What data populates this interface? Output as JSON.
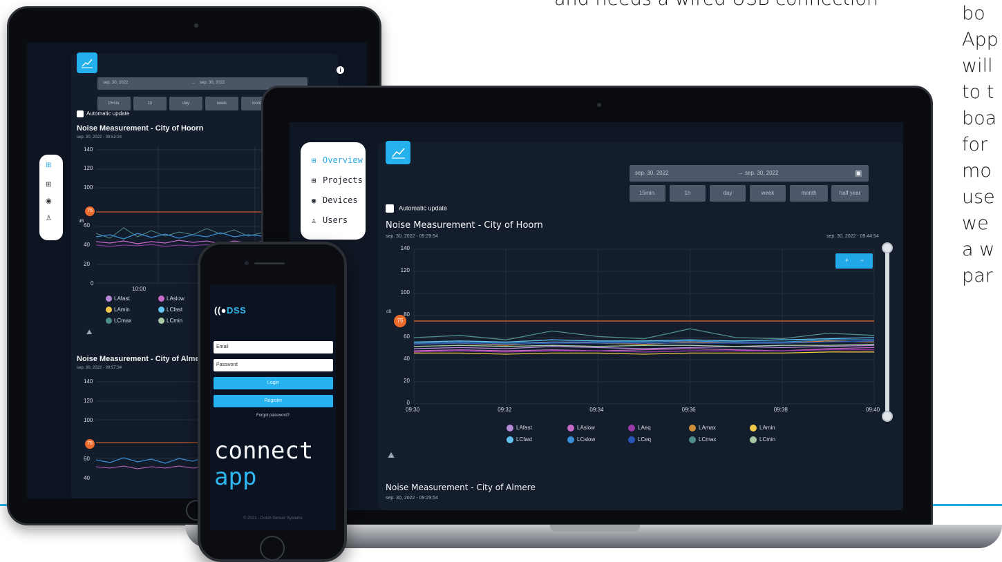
{
  "background": {
    "top_text": "and needs a wired USB connection",
    "right_text_lines": [
      "bo",
      "App",
      "will",
      "to t",
      "boa",
      "for",
      "mo",
      "use",
      "we",
      "a w",
      "par"
    ]
  },
  "colors": {
    "accent": "#25b1ec",
    "threshold": "#ec6b2a",
    "panel": "#141d2b",
    "screen_bg": "#0f1724"
  },
  "tablet": {
    "sidebar_icons": [
      "overview-icon",
      "projects-icon",
      "devices-icon",
      "users-icon"
    ],
    "date_from": "sep. 30, 2022",
    "date_to": "sep. 30, 2022",
    "range_buttons": [
      "15min.",
      "1h",
      "day",
      "week",
      "month"
    ],
    "auto_update": "Automatic update",
    "chart1_title": "Noise Measurement - City of Hoorn",
    "chart1_sub": "sep. 30, 2022 - 09:52:34",
    "chart2_title": "Noise Measurement - City of Almere",
    "chart2_sub": "sep. 30, 2022 - 09:57:34",
    "y_ticks": [
      "140",
      "120",
      "100",
      "60",
      "40",
      "20",
      "0"
    ],
    "y_ticks2": [
      "140",
      "120",
      "100",
      "60",
      "40"
    ],
    "threshold": "75",
    "unit": "dB",
    "x_tick": "10:00",
    "legend": [
      {
        "label": "LAfast",
        "color": "#b78ad8"
      },
      {
        "label": "LAslow",
        "color": "#c66bc8"
      },
      {
        "label": "LAmin",
        "color": "#f1c84a"
      },
      {
        "label": "LCfast",
        "color": "#62c3ef"
      },
      {
        "label": "LCmax",
        "color": "#4f8e8a"
      },
      {
        "label": "LCmin",
        "color": "#a7c7a5"
      }
    ]
  },
  "laptop": {
    "nav": [
      {
        "label": "Overview",
        "icon": "overview-icon",
        "active": true
      },
      {
        "label": "Projects",
        "icon": "projects-icon",
        "active": false
      },
      {
        "label": "Devices",
        "icon": "devices-icon",
        "active": false
      },
      {
        "label": "Users",
        "icon": "users-icon",
        "active": false
      }
    ],
    "date_from": "sep. 30, 2022",
    "date_arrow": "→",
    "date_to": "sep. 30, 2022",
    "range_buttons": [
      "15min.",
      "1h",
      "day",
      "week",
      "month",
      "half year"
    ],
    "auto_update": "Automatic update",
    "chart_title": "Noise Measurement - City of Hoorn",
    "chart_sub_left": "sep. 30, 2022 - 09:29:54",
    "chart_sub_right": "sep. 30, 2022 - 09:44:54",
    "zoom_plus": "+",
    "zoom_minus": "−",
    "unit": "dB",
    "threshold_label": "75",
    "legend": [
      {
        "label": "LAfast",
        "color": "#b78ad8"
      },
      {
        "label": "LAslow",
        "color": "#c66bc8"
      },
      {
        "label": "LAeq",
        "color": "#9a3aa6"
      },
      {
        "label": "LAmax",
        "color": "#d18f3c"
      },
      {
        "label": "LAmin",
        "color": "#f1c84a"
      },
      {
        "label": "LCfast",
        "color": "#62c3ef"
      },
      {
        "label": "LCslow",
        "color": "#3b8fd6"
      },
      {
        "label": "LCeq",
        "color": "#2a55b8"
      },
      {
        "label": "LCmax",
        "color": "#4f8e8a"
      },
      {
        "label": "LCmin",
        "color": "#a7c7a5"
      }
    ],
    "chart2_title": "Noise Measurement - City of Almere",
    "chart2_sub": "sep. 30, 2022 - 09:29:54"
  },
  "phone": {
    "logo_prefix": "((●",
    "logo_text": "DSS",
    "email_placeholder": "Email",
    "password_placeholder": "Password",
    "login": "Login",
    "register": "Register",
    "forgot": "Forgot password?",
    "brand_line1": "connect",
    "brand_line2": "app",
    "footer": "© 2021 - Dutch Sensor Systems"
  },
  "chart_data": {
    "type": "line",
    "title": "Noise Measurement - City of Hoorn",
    "ylabel": "dB",
    "ylim": [
      0,
      140
    ],
    "yticks": [
      0,
      20,
      40,
      60,
      80,
      100,
      120,
      140
    ],
    "x": [
      "09:30",
      "09:31",
      "09:32",
      "09:33",
      "09:34",
      "09:35",
      "09:36",
      "09:37",
      "09:38",
      "09:39",
      "09:40"
    ],
    "xticks": [
      "09:30",
      "09:32",
      "09:34",
      "09:36",
      "09:38",
      "09:40"
    ],
    "threshold": 75,
    "grid": true,
    "legend_position": "bottom",
    "series": [
      {
        "name": "LAfast",
        "color": "#b78ad8",
        "values": [
          50,
          51,
          50,
          52,
          51,
          50,
          51,
          52,
          51,
          52,
          53
        ]
      },
      {
        "name": "LAslow",
        "color": "#c66bc8",
        "values": [
          48,
          49,
          48,
          49,
          48,
          49,
          50,
          49,
          48,
          50,
          51
        ]
      },
      {
        "name": "LAeq",
        "color": "#9a3aa6",
        "values": [
          47,
          48,
          47,
          48,
          48,
          47,
          48,
          48,
          48,
          49,
          49
        ]
      },
      {
        "name": "LAmax",
        "color": "#d18f3c",
        "values": [
          54,
          55,
          53,
          56,
          55,
          54,
          56,
          55,
          55,
          57,
          56
        ]
      },
      {
        "name": "LAmin",
        "color": "#f1c84a",
        "values": [
          46,
          46,
          45,
          46,
          46,
          45,
          46,
          46,
          46,
          47,
          47
        ]
      },
      {
        "name": "LCfast",
        "color": "#62c3ef",
        "values": [
          56,
          57,
          56,
          58,
          57,
          57,
          58,
          57,
          58,
          59,
          60
        ]
      },
      {
        "name": "LCslow",
        "color": "#3b8fd6",
        "values": [
          55,
          56,
          55,
          56,
          56,
          56,
          57,
          56,
          56,
          58,
          58
        ]
      },
      {
        "name": "LCeq",
        "color": "#2a55b8",
        "values": [
          54,
          55,
          54,
          55,
          55,
          55,
          55,
          55,
          55,
          56,
          57
        ]
      },
      {
        "name": "LCmax",
        "color": "#4f8e8a",
        "values": [
          60,
          62,
          58,
          66,
          61,
          59,
          68,
          60,
          59,
          64,
          62
        ]
      },
      {
        "name": "LCmin",
        "color": "#a7c7a5",
        "values": [
          52,
          53,
          52,
          53,
          52,
          53,
          53,
          52,
          53,
          53,
          54
        ]
      }
    ]
  }
}
